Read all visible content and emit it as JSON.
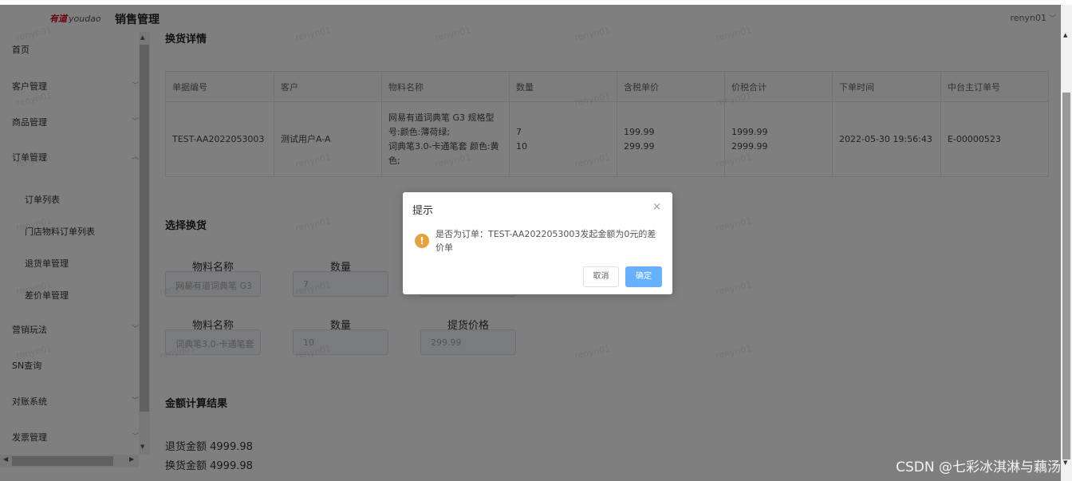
{
  "header": {
    "logo_cn": "有道",
    "logo_en": "youdao",
    "app_title": "销售管理",
    "user": "renyn01",
    "user_chevron": "﹀"
  },
  "sidebar": {
    "items": [
      {
        "label": "首页",
        "expandable": false
      },
      {
        "label": "客户管理",
        "expandable": true
      },
      {
        "label": "商品管理",
        "expandable": true
      },
      {
        "label": "订单管理",
        "expandable": true,
        "expanded": true
      },
      {
        "label": "订单列表",
        "sub": true
      },
      {
        "label": "门店物料订单列表",
        "sub": true
      },
      {
        "label": "退货单管理",
        "sub": true
      },
      {
        "label": "差价单管理",
        "sub": true
      },
      {
        "label": "营销玩法",
        "expandable": true
      },
      {
        "label": "SN查询",
        "expandable": false
      },
      {
        "label": "对账系统",
        "expandable": true
      },
      {
        "label": "发票管理",
        "expandable": true
      }
    ]
  },
  "detail": {
    "title": "换货详情",
    "columns": [
      "单据编号",
      "客户",
      "物料名称",
      "数量",
      "含税单价",
      "价税合计",
      "下单时间",
      "中台主订单号"
    ],
    "row": {
      "order_no": "TEST-AA2022053003",
      "customer": "测试用户A-A",
      "material_line1": "网易有道词典笔 G3 规格型",
      "material_line2": "号:颜色:薄荷绿;",
      "material_line3": "词典笔3.0-卡通笔套 颜色:黄",
      "material_line4": "色;",
      "qty_1": "7",
      "qty_2": "10",
      "unit_price_1": "199.99",
      "unit_price_2": "299.99",
      "total_1": "1999.99",
      "total_2": "2999.99",
      "order_time": "2022-05-30 19:56:43",
      "main_order_no": "E-00000523"
    }
  },
  "exchange": {
    "title": "选择换货",
    "label_material": "物料名称",
    "label_qty": "数量",
    "label_price": "提货价格",
    "rows": [
      {
        "material": "网易有道词典笔 G3",
        "qty": "7",
        "price": ""
      },
      {
        "material": "词典笔3.0-卡通笔套",
        "qty": "10",
        "price": "299.99"
      }
    ]
  },
  "calc": {
    "title": "金额计算结果",
    "return_amount": "退货金额 4999.98",
    "exchange_amount": "换货金额 4999.98"
  },
  "dialog": {
    "title": "提示",
    "close_icon": "×",
    "warning_icon": "!",
    "message": "是否为订单：TEST-AA2022053003发起金额为0元的差价单",
    "cancel_label": "取消",
    "ok_label": "确定",
    "ok_color": "#66b1ff",
    "warning_color": "#e6a23c"
  },
  "watermark_text": "renyn01",
  "footer_watermark": "CSDN @七彩冰淇淋与藕汤",
  "scroll_icons": {
    "up": "▲",
    "down": "▼",
    "left": "◀",
    "right": "▶"
  }
}
